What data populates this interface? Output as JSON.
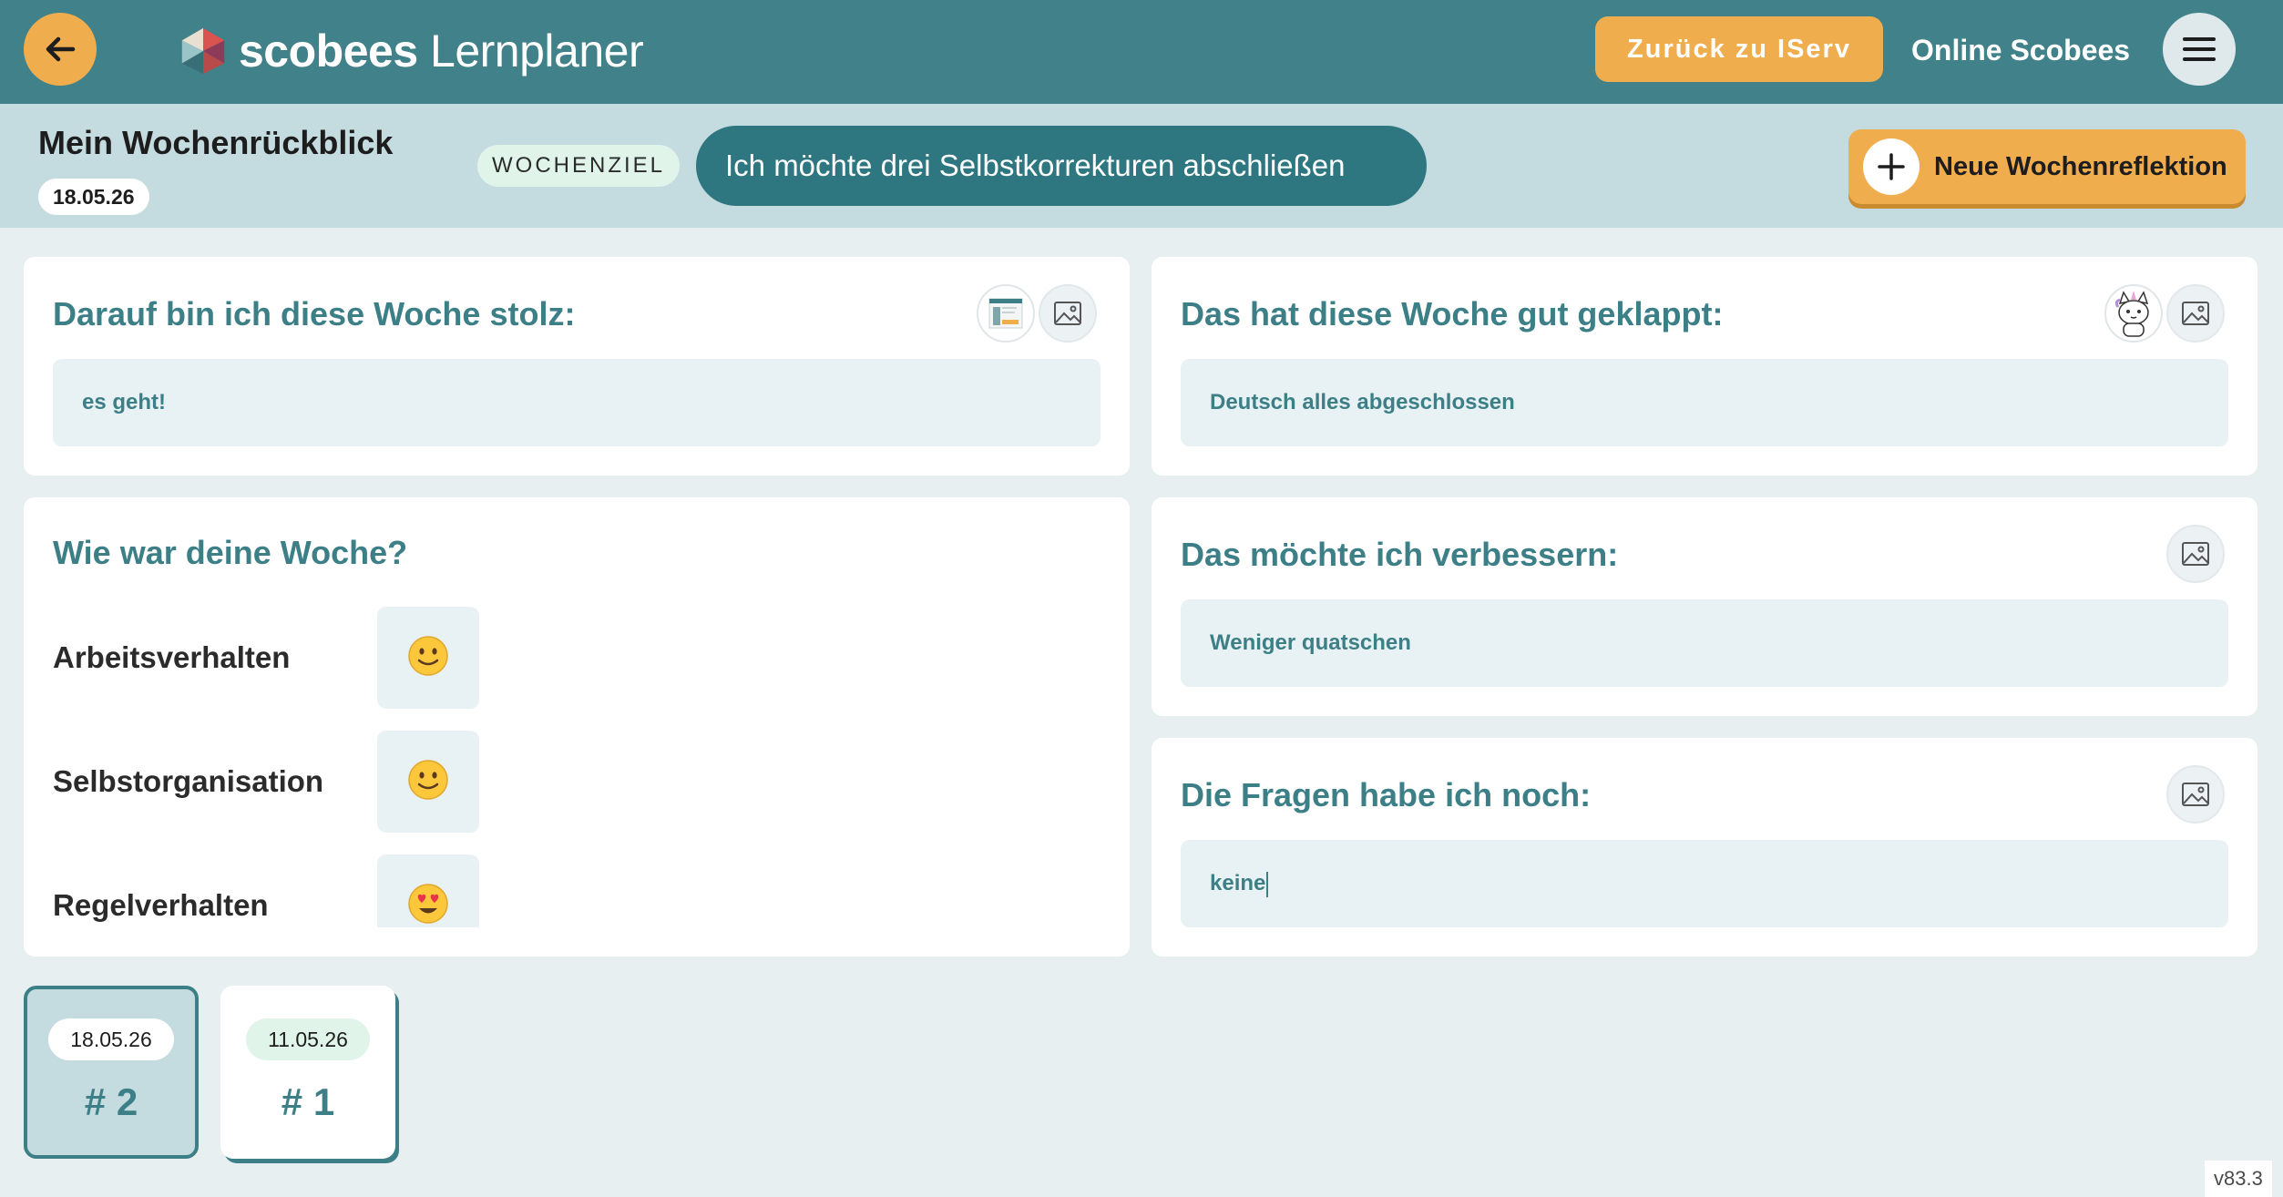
{
  "topbar": {
    "logo_bold": "scobees",
    "logo_light": "Lernplaner",
    "iserv_label": "Zurück zu IServ",
    "online_label": "Online Scobees"
  },
  "header": {
    "title": "Mein Wochenrückblick",
    "date": "18.05.26",
    "goal_label": "WOCHENZIEL",
    "goal_text": "Ich möchte drei Selbstkorrekturen abschließen",
    "new_button_label": "Neue Wochenreflektion"
  },
  "cards": {
    "proud": {
      "title": "Darauf bin ich diese Woche stolz:",
      "value": "es geht!"
    },
    "good": {
      "title": "Das hat diese Woche gut geklappt:",
      "value": "Deutsch alles abgeschlossen"
    },
    "week": {
      "title": "Wie war deine Woche?",
      "ratings": [
        {
          "label": "Arbeitsverhalten",
          "emoji": "🙂"
        },
        {
          "label": "Selbstorganisation",
          "emoji": "🙂"
        },
        {
          "label": "Regelverhalten",
          "emoji": "😍"
        }
      ]
    },
    "improve": {
      "title": "Das möchte ich verbessern:",
      "value": "Weniger quatschen"
    },
    "questions": {
      "title": "Die Fragen habe ich noch:",
      "value": "keine"
    }
  },
  "weeks": [
    {
      "date": "18.05.26",
      "number": "# 2"
    },
    {
      "date": "11.05.26",
      "number": "# 1"
    }
  ],
  "version": "v83.3",
  "colors": {
    "topbar": "#40818a",
    "accent_orange": "#f0ad4e",
    "teal_text": "#3c7f87",
    "subheader": "#c4dbe0"
  }
}
